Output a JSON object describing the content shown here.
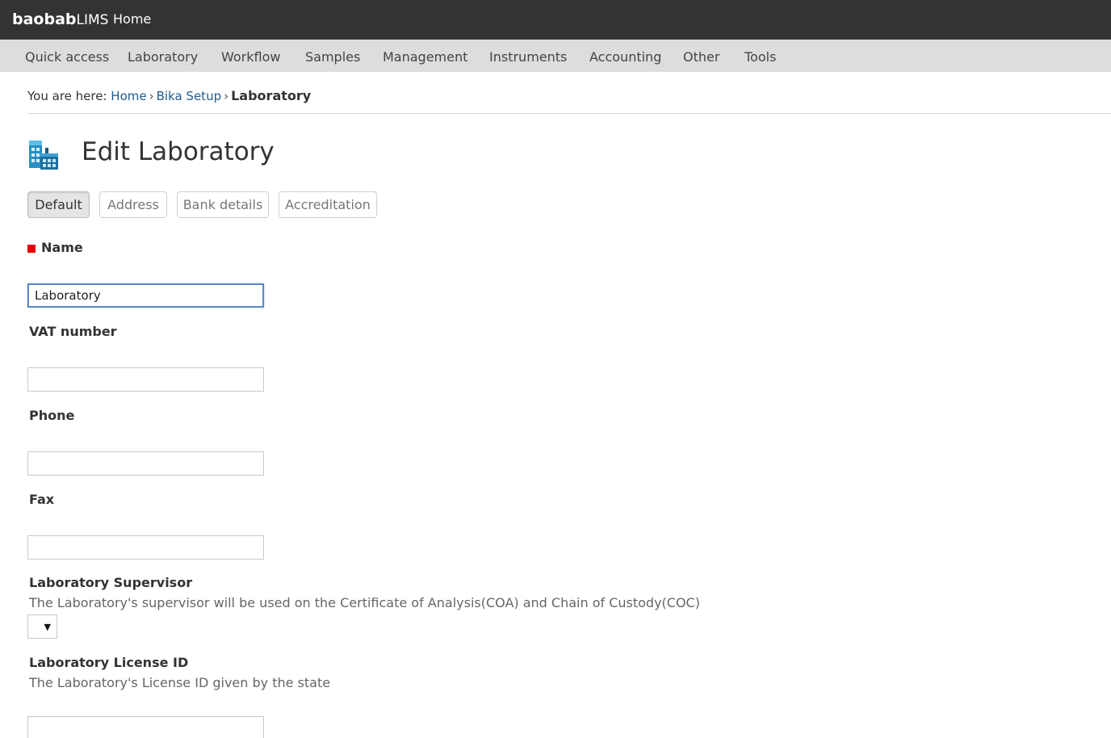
{
  "topbar": {
    "brand_bold": "baobab",
    "brand_light": "LIMS",
    "home_label": "Home"
  },
  "nav": {
    "items": [
      "Quick access",
      "Laboratory",
      "Workflow",
      "Samples",
      "Management",
      "Instruments",
      "Accounting",
      "Other",
      "Tools"
    ]
  },
  "breadcrumb": {
    "prefix": "You are here:",
    "items": [
      "Home",
      "Bika Setup"
    ],
    "separator": "›",
    "current": "Laboratory"
  },
  "page": {
    "title": "Edit Laboratory",
    "icon": "laboratory-building-icon"
  },
  "tabs": [
    {
      "label": "Default",
      "active": true
    },
    {
      "label": "Address",
      "active": false
    },
    {
      "label": "Bank details",
      "active": false
    },
    {
      "label": "Accreditation",
      "active": false
    }
  ],
  "form": {
    "name": {
      "label": "Name",
      "value": "Laboratory",
      "required": true
    },
    "vat": {
      "label": "VAT number",
      "value": ""
    },
    "phone": {
      "label": "Phone",
      "value": ""
    },
    "fax": {
      "label": "Fax",
      "value": ""
    },
    "supervisor": {
      "label": "Laboratory Supervisor",
      "help": "The Laboratory's supervisor will be used on the Certificate of Analysis(COA) and Chain of Custody(COC)",
      "selected": "",
      "arrow": "▼"
    },
    "license": {
      "label": "Laboratory License ID",
      "help": "The Laboratory's License ID given by the state",
      "value": ""
    }
  },
  "colors": {
    "topbar": "#333333",
    "navbar": "#dddddd",
    "link": "#205c90",
    "required": "#e30000",
    "focus": "#5b8ac6"
  }
}
